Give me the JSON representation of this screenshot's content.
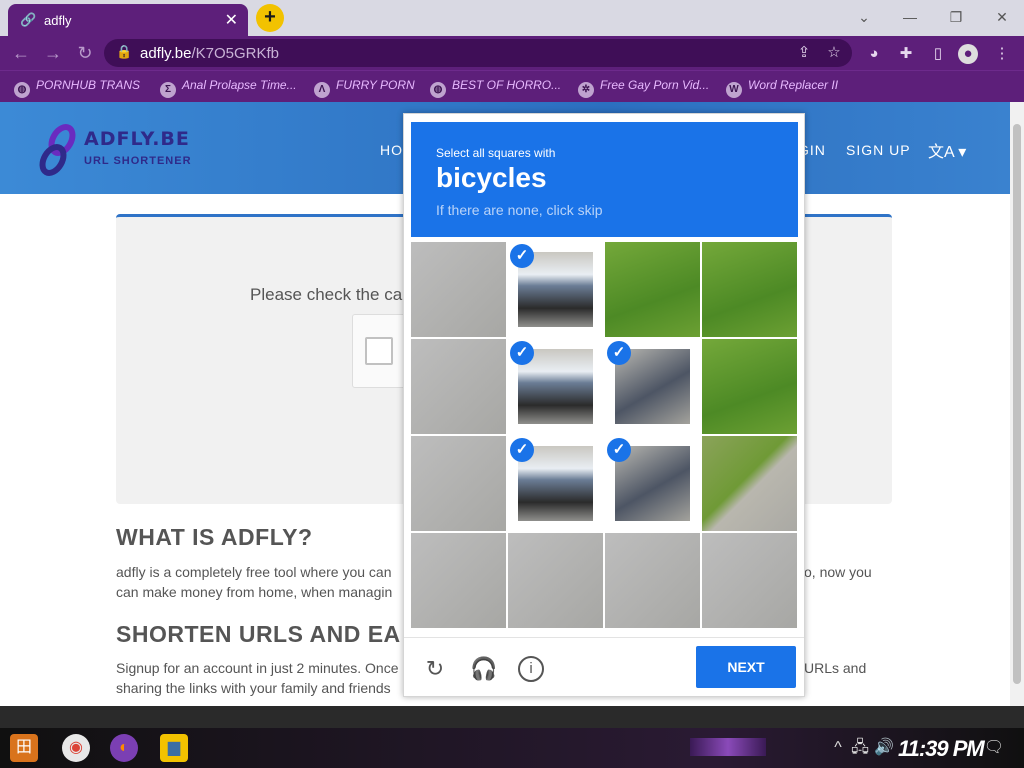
{
  "browser": {
    "tab_title": "adfly",
    "url_host": "adfly.be",
    "url_path": "/K7O5GRKfb",
    "bookmarks": [
      "PORNHUB TRANS",
      "Anal Prolapse Time...",
      "FURRY PORN",
      "BEST OF HORRO...",
      "Free Gay Porn Vid...",
      "Word Replacer II"
    ]
  },
  "site": {
    "logo_title": "ADFLY.BE",
    "logo_subtitle": "URL SHORTENER",
    "nav": {
      "home": "HO",
      "login": "GIN",
      "signup": "SIGN UP"
    },
    "check_text": "Please check the ca",
    "section1_title": "WHAT IS ADFLY?",
    "section1_line1": "adfly is a completely free tool where you can",
    "section1_line1_end": "o, now you",
    "section1_line2": "can make money from home, when managin",
    "section2_title": "SHORTEN URLS AND EA",
    "section2_line1": "Signup for an account in just 2 minutes. Once",
    "section2_line1_end": "URLs and",
    "section2_line2": "sharing the links with your family and friends"
  },
  "captcha": {
    "instruction": "Select all squares with",
    "target": "bicycles",
    "hint": "If there are none, click skip",
    "next_label": "NEXT",
    "tiles": [
      {
        "selected": false,
        "kind": "road"
      },
      {
        "selected": true,
        "kind": "rider"
      },
      {
        "selected": false,
        "kind": "grass"
      },
      {
        "selected": false,
        "kind": "grass"
      },
      {
        "selected": false,
        "kind": "road"
      },
      {
        "selected": true,
        "kind": "rider"
      },
      {
        "selected": true,
        "kind": "shadow"
      },
      {
        "selected": false,
        "kind": "grass"
      },
      {
        "selected": false,
        "kind": "road"
      },
      {
        "selected": true,
        "kind": "rider"
      },
      {
        "selected": true,
        "kind": "shadow"
      },
      {
        "selected": false,
        "kind": "mix"
      },
      {
        "selected": false,
        "kind": "road"
      },
      {
        "selected": false,
        "kind": "road"
      },
      {
        "selected": false,
        "kind": "road"
      },
      {
        "selected": false,
        "kind": "road"
      }
    ]
  },
  "taskbar": {
    "clock": "11:39 PM"
  }
}
